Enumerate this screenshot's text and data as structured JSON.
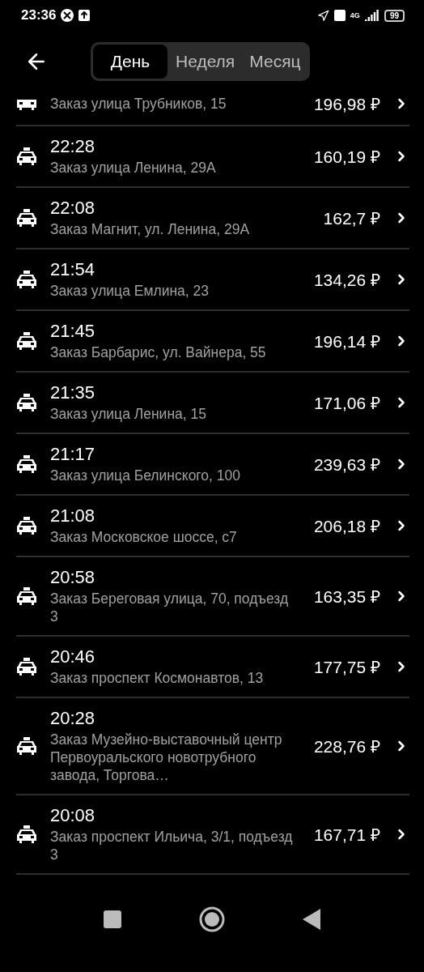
{
  "status_bar": {
    "time": "23:36",
    "network": "4G",
    "battery": "99"
  },
  "tabs": [
    {
      "label": "День",
      "selected": true
    },
    {
      "label": "Неделя",
      "selected": false
    },
    {
      "label": "Месяц",
      "selected": false
    }
  ],
  "orders": [
    {
      "kind": "partial",
      "address": "Заказ улица Трубников, 15",
      "price": "196,98 ₽"
    },
    {
      "kind": "full",
      "time": "22:28",
      "address": "Заказ улица Ленина, 29А",
      "price": "160,19 ₽"
    },
    {
      "kind": "full",
      "time": "22:08",
      "address": "Заказ Магнит, ул. Ленина, 29А",
      "price": "162,7 ₽"
    },
    {
      "kind": "full",
      "time": "21:54",
      "address": "Заказ улица Емлина, 23",
      "price": "134,26 ₽"
    },
    {
      "kind": "full",
      "time": "21:45",
      "address": "Заказ Барбарис, ул. Вайнера, 55",
      "price": "196,14 ₽"
    },
    {
      "kind": "full",
      "time": "21:35",
      "address": "Заказ улица Ленина, 15",
      "price": "171,06 ₽"
    },
    {
      "kind": "full",
      "time": "21:17",
      "address": "Заказ улица Белинского, 100",
      "price": "239,63 ₽"
    },
    {
      "kind": "full",
      "time": "21:08",
      "address": "Заказ Московское шоссе, с7",
      "price": "206,18 ₽"
    },
    {
      "kind": "full",
      "time": "20:58",
      "address": "Заказ Береговая улица, 70, подъезд 3",
      "price": "163,35 ₽"
    },
    {
      "kind": "full",
      "time": "20:46",
      "address": "Заказ проспект Космонавтов, 13",
      "price": "177,75 ₽"
    },
    {
      "kind": "full",
      "time": "20:28",
      "address": "Заказ Музейно-выставочный центр Первоуральского новотрубного завода, Торгова…",
      "price": "228,76 ₽"
    },
    {
      "kind": "full",
      "time": "20:08",
      "address": "Заказ проспект Ильича, 3/1, подъезд 3",
      "price": "167,71 ₽"
    }
  ]
}
